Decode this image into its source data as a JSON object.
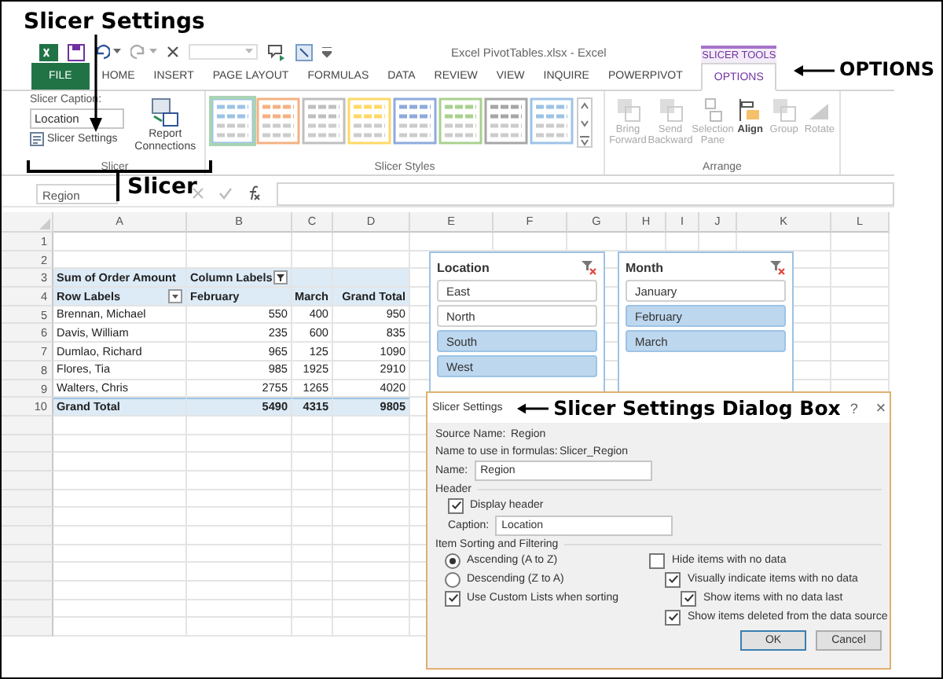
{
  "callouts": {
    "slicer_settings": "Slicer Settings",
    "slicer_group": "Slicer",
    "options_tab": "OPTIONS",
    "dialog": "Slicer Settings Dialog Box"
  },
  "window": {
    "title": "Excel PivotTables.xlsx - Excel"
  },
  "contextual_group": "SLICER TOOLS",
  "tabs": [
    {
      "label": "FILE",
      "kind": "file",
      "selected": false
    },
    {
      "label": "HOME",
      "kind": "tab",
      "selected": false
    },
    {
      "label": "INSERT",
      "kind": "tab",
      "selected": false
    },
    {
      "label": "PAGE LAYOUT",
      "kind": "tab",
      "selected": false
    },
    {
      "label": "FORMULAS",
      "kind": "tab",
      "selected": false
    },
    {
      "label": "DATA",
      "kind": "tab",
      "selected": false
    },
    {
      "label": "REVIEW",
      "kind": "tab",
      "selected": false
    },
    {
      "label": "VIEW",
      "kind": "tab",
      "selected": false
    },
    {
      "label": "INQUIRE",
      "kind": "tab",
      "selected": false
    },
    {
      "label": "POWERPIVOT",
      "kind": "tab",
      "selected": false
    },
    {
      "label": "OPTIONS",
      "kind": "contextual",
      "selected": true
    }
  ],
  "ribbon": {
    "slicer": {
      "caption_label": "Slicer Caption:",
      "caption_value": "Location",
      "settings_button": "Slicer Settings",
      "report_connections": "Report Connections",
      "group_label": "Slicer"
    },
    "slicer_styles": {
      "group_label": "Slicer Styles",
      "swatches": [
        {
          "color": "#9dc3e6",
          "selected": true
        },
        {
          "color": "#f4b183",
          "selected": false
        },
        {
          "color": "#bfbfbf",
          "selected": false
        },
        {
          "color": "#ffd966",
          "selected": false
        },
        {
          "color": "#8faadc",
          "selected": false
        },
        {
          "color": "#a9d18e",
          "selected": false
        },
        {
          "color": "#a6a6a6",
          "selected": false
        },
        {
          "color": "#9dc3e6",
          "selected": false
        }
      ]
    },
    "arrange": {
      "group_label": "Arrange",
      "buttons": [
        {
          "label": "Bring Forward",
          "disabled": true
        },
        {
          "label": "Send Backward",
          "disabled": true
        },
        {
          "label": "Selection Pane",
          "disabled": true
        },
        {
          "label": "Align",
          "disabled": false
        },
        {
          "label": "Group",
          "disabled": true
        },
        {
          "label": "Rotate",
          "disabled": true
        }
      ]
    }
  },
  "formula_bar": {
    "name_box": "Region"
  },
  "sheet": {
    "columns": [
      "A",
      "B",
      "C",
      "D",
      "E",
      "F",
      "G",
      "H",
      "I",
      "J",
      "K",
      "L"
    ],
    "row_numbers": [
      "1",
      "2",
      "3",
      "4",
      "5",
      "6",
      "7",
      "8",
      "9",
      "10"
    ]
  },
  "pivot": {
    "value_field": "Sum of Order Amount",
    "column_labels": "Column Labels",
    "row_labels": "Row Labels",
    "column_headers": [
      "February",
      "March",
      "Grand Total"
    ],
    "rows": [
      {
        "label": "Brennan, Michael",
        "values": [
          "550",
          "400",
          "950"
        ]
      },
      {
        "label": "Davis, William",
        "values": [
          "235",
          "600",
          "835"
        ]
      },
      {
        "label": "Dumlao, Richard",
        "values": [
          "965",
          "125",
          "1090"
        ]
      },
      {
        "label": "Flores, Tia",
        "values": [
          "985",
          "1925",
          "2910"
        ]
      },
      {
        "label": "Walters, Chris",
        "values": [
          "2755",
          "1265",
          "4020"
        ]
      }
    ],
    "total": {
      "label": "Grand Total",
      "values": [
        "5490",
        "4315",
        "9805"
      ]
    }
  },
  "slicers": [
    {
      "title": "Location",
      "items": [
        {
          "label": "East",
          "selected": false
        },
        {
          "label": "North",
          "selected": false
        },
        {
          "label": "South",
          "selected": true
        },
        {
          "label": "West",
          "selected": true
        }
      ]
    },
    {
      "title": "Month",
      "items": [
        {
          "label": "January",
          "selected": false
        },
        {
          "label": "February",
          "selected": true
        },
        {
          "label": "March",
          "selected": true
        }
      ]
    }
  ],
  "dialog": {
    "title": "Slicer Settings",
    "help": "?",
    "close": "×",
    "source_name_label": "Source Name:",
    "source_name": "Region",
    "formula_name_label": "Name to use in formulas:",
    "formula_name": "Slicer_Region",
    "name_label": "Name:",
    "name_value": "Region",
    "header_section": "Header",
    "display_header": {
      "label": "Display header",
      "checked": true
    },
    "caption_label": "Caption:",
    "caption_value": "Location",
    "sorting_section": "Item Sorting and Filtering",
    "sort_order": [
      {
        "label": "Ascending (A to Z)",
        "selected": true
      },
      {
        "label": "Descending (Z to A)",
        "selected": false
      }
    ],
    "custom_lists": {
      "label": "Use Custom Lists when sorting",
      "checked": true
    },
    "filter_options": [
      {
        "label": "Hide items with no data",
        "checked": false,
        "children": [
          {
            "label": "Visually indicate items with no data",
            "checked": true,
            "children": [
              {
                "label": "Show items with no data last",
                "checked": true
              }
            ]
          },
          {
            "label": "Show items deleted from the data source",
            "checked": true
          }
        ]
      }
    ],
    "buttons": [
      {
        "label": "OK",
        "kind": "default"
      },
      {
        "label": "Cancel",
        "kind": "normal"
      }
    ]
  }
}
